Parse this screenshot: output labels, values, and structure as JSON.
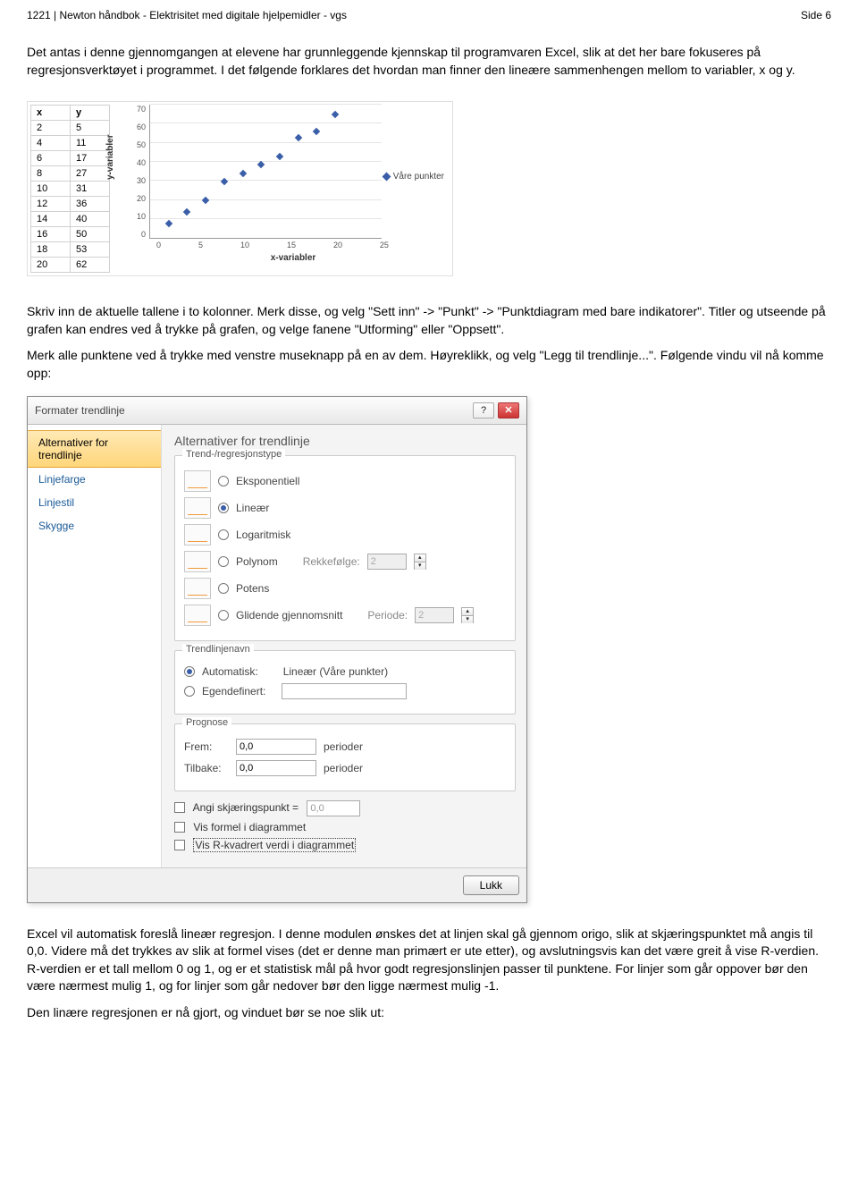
{
  "header": {
    "left": "1221 | Newton håndbok - Elektrisitet med digitale hjelpemidler - vgs",
    "right": "Side 6"
  },
  "para1": "Det antas i denne gjennomgangen at elevene har grunnleggende kjennskap til programvaren Excel, slik at det her bare fokuseres på regresjonsverktøyet i programmet. I det følgende forklares det hvordan man finner den lineære sammenhengen mellom to variabler, x og y.",
  "chart_data": {
    "type": "scatter",
    "x": [
      2,
      4,
      6,
      8,
      10,
      12,
      14,
      16,
      18,
      20
    ],
    "y": [
      5,
      11,
      17,
      27,
      31,
      36,
      40,
      50,
      53,
      62
    ],
    "xlabel": "x-variabler",
    "ylabel": "y-variabler",
    "xlim": [
      0,
      25
    ],
    "ylim": [
      0,
      70
    ],
    "x_ticks": [
      0,
      5,
      10,
      15,
      20,
      25
    ],
    "y_ticks": [
      0,
      10,
      20,
      30,
      40,
      50,
      60,
      70
    ],
    "legend_label": "Våre punkter",
    "table_headers": [
      "x",
      "y"
    ]
  },
  "para2": "Skriv inn de aktuelle tallene i to kolonner. Merk disse, og velg \"Sett inn\" -> \"Punkt\" -> \"Punktdiagram med bare indikatorer\". Titler og utseende på grafen kan endres ved å trykke på grafen, og velge fanene \"Utforming\" eller \"Oppsett\".",
  "para3": "Merk alle punktene ved å trykke med venstre museknapp på en av dem. Høyreklikk, og velg \"Legg til trendlinje...\". Følgende vindu vil nå komme opp:",
  "dialog": {
    "title": "Formater trendlinje",
    "side_items": [
      "Alternativer for trendlinje",
      "Linjefarge",
      "Linjestil",
      "Skygge"
    ],
    "panel_heading": "Alternativer for trendlinje",
    "group_type": "Trend-/regresjonstype",
    "types": [
      {
        "label": "Eksponentiell",
        "checked": false
      },
      {
        "label": "Lineær",
        "checked": true
      },
      {
        "label": "Logaritmisk",
        "checked": false
      },
      {
        "label": "Polynom",
        "checked": false,
        "extra": "Rekkefølge:",
        "extra_val": "2"
      },
      {
        "label": "Potens",
        "checked": false
      },
      {
        "label": "Glidende gjennomsnitt",
        "checked": false,
        "extra": "Periode:",
        "extra_val": "2"
      }
    ],
    "group_name": "Trendlinjenavn",
    "name_auto_label": "Automatisk:",
    "name_auto_value": "Lineær (Våre punkter)",
    "name_custom_label": "Egendefinert:",
    "group_prog": "Prognose",
    "prog_frem_label": "Frem:",
    "prog_tilbake_label": "Tilbake:",
    "prog_val": "0,0",
    "prog_unit": "perioder",
    "check1": "Angi skjæringspunkt =",
    "check1_val": "0,0",
    "check2": "Vis formel i diagrammet",
    "check3": "Vis R-kvadrert verdi i diagrammet",
    "close": "Lukk"
  },
  "para4": "Excel vil automatisk foreslå lineær regresjon. I denne modulen ønskes det at linjen skal gå gjennom origo, slik at skjæringspunktet må angis til 0,0. Videre må det trykkes av slik at formel vises (det er denne man primært er ute etter), og avslutningsvis kan det være greit å vise R-verdien. R-verdien er et tall mellom 0 og 1, og er et statistisk mål på hvor godt regresjonslinjen passer til punktene. For linjer som går oppover bør den være nærmest mulig 1, og for linjer som går nedover bør den ligge nærmest mulig -1.",
  "para5": "Den linære regresjonen er nå gjort, og vinduet bør se noe slik ut:"
}
